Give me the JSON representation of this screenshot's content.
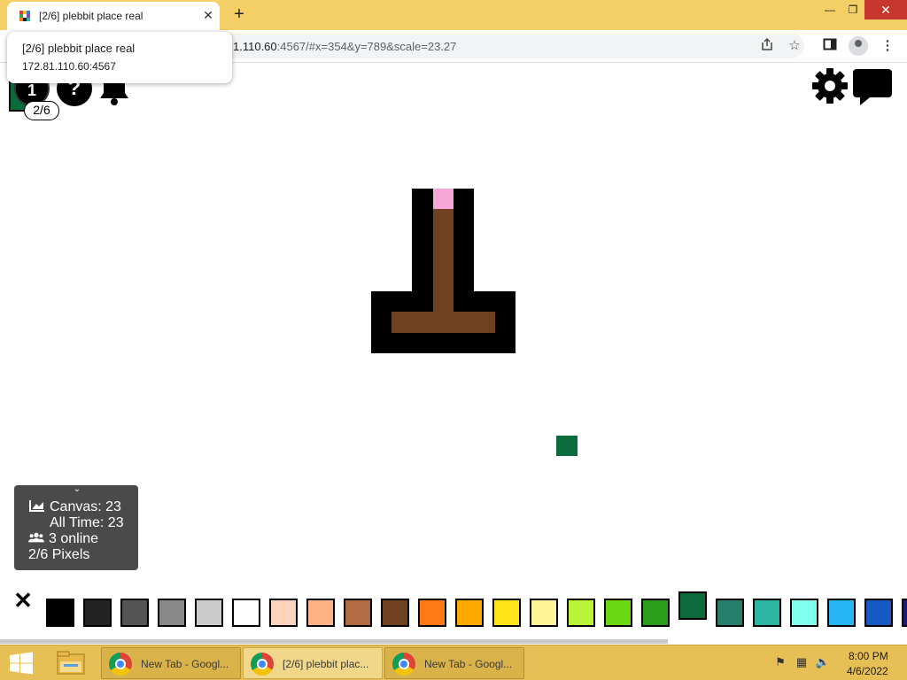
{
  "browser": {
    "tab_title": "[2/6] plebbit place real",
    "tab_close": "✕",
    "new_tab": "+",
    "window_controls": {
      "minimize": "—",
      "restore": "❐",
      "close": "✕"
    },
    "url_host": "172.81.110.60",
    "url_rest": ":4567/#x=354&y=789&scale=23.27",
    "url_visible_host": "1.110.60",
    "tooltip": {
      "title": "[2/6] plebbit place real",
      "host": "172.81.110.60:4567"
    },
    "icons": [
      "share-icon",
      "star-icon",
      "side-panel-icon",
      "profile-icon",
      "menu-icon"
    ]
  },
  "topbar": {
    "counter_value": "1",
    "counter_badge": "2/6",
    "help_symbol": "?",
    "icons": [
      "pixel-counter-icon",
      "help-icon",
      "bell-icon",
      "settings-icon",
      "chat-icon"
    ]
  },
  "stats": {
    "canvas": "Canvas: 23",
    "all_time": "All Time: 23",
    "online": "3 online",
    "pixels": "2/6 Pixels",
    "collapse_symbol": "⌄"
  },
  "palette": {
    "close_symbol": "✕",
    "selected_index": 17,
    "colors": [
      "#000000",
      "#222222",
      "#555555",
      "#888888",
      "#cccccc",
      "#ffffff",
      "#ffd3bb",
      "#ffb386",
      "#b46a42",
      "#704120",
      "#ff7a14",
      "#ffa800",
      "#ffe41a",
      "#fff497",
      "#b8f538",
      "#6ad912",
      "#2d9e1c",
      "#0b6b3a",
      "#27806d",
      "#2ab6a2",
      "#81ffee",
      "#26b4f4",
      "#1659c5",
      "#1a1a6e"
    ]
  },
  "canvas_colors": {
    "outline": "#000000",
    "wood": "#704120",
    "tip": "#f7a8d8",
    "placed_pixel": "#0b6b3a"
  },
  "taskbar": {
    "tasks": [
      {
        "label": "New Tab - Googl...",
        "active": false
      },
      {
        "label": "[2/6] plebbit plac...",
        "active": true
      },
      {
        "label": "New Tab - Googl...",
        "active": false
      }
    ],
    "clock_time": "8:00 PM",
    "clock_date": "4/6/2022",
    "tray_icons": [
      "action-center-flag-icon",
      "network-icon",
      "volume-muted-icon"
    ]
  }
}
